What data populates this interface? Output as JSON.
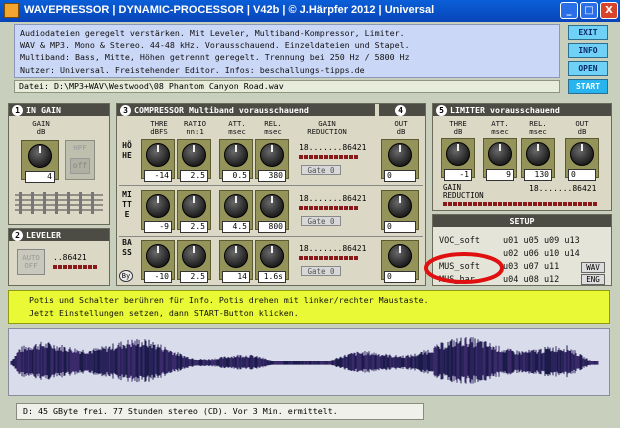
{
  "window": {
    "title": "WAVEPRESSOR | DYNAMIC-PROCESSOR | V42b | © J.Härpfer 2012 | Universal",
    "buttons": {
      "minimize": "_",
      "maximize": "□",
      "close": "X"
    }
  },
  "info": {
    "lines": [
      "Audiodateien geregelt verstärken.  Mit Leveler, Multiband-Kompressor, Limiter.",
      "WAV & MP3. Mono & Stereo. 44-48 kHz. Vorausschauend. Einzeldateien und Stapel.",
      "Multiband: Bass, Mitte, Höhen getrennt geregelt. Trennung bei 250 Hz / 5800 Hz",
      "Nutzer: Universal.     Freistehender Editor. Infos: beschallungs-tipps.de"
    ]
  },
  "side_buttons": {
    "exit": "EXIT",
    "info": "INFO",
    "open": "OPEN",
    "start": "START"
  },
  "file": "Datei: D:\\MP3+WAV\\Westwood\\08 Phantom Canyon Road.wav",
  "in_gain": {
    "number": "1",
    "title": "IN GAIN",
    "gain_label": "GAIN\ndB",
    "gain_value": "4",
    "hpf_label": "HPF",
    "hpf_state": "off"
  },
  "leveler": {
    "number": "2",
    "title": "LEVELER",
    "auto_label": "AUTO\nOFF",
    "meter_label": "..86421"
  },
  "compressor": {
    "number": "3",
    "title": "COMPRESSOR  Multiband  vorausschauend",
    "out_number": "4",
    "headers": {
      "thre": "THRE\ndBFS",
      "ratio": "RATIO\nnn:1",
      "att": "ATT.\nmsec",
      "rel": "REL.\nmsec",
      "gr": "GAIN\nREDUCTION",
      "out": "OUT\ndB"
    },
    "bands": [
      {
        "name": "HÖHE",
        "thre": "-14",
        "ratio": "2.5",
        "att": "0.5",
        "rel": "380",
        "meter": "18.......86421",
        "gate": "Gate 0",
        "out": "0"
      },
      {
        "name": "MITTE",
        "thre": "-9",
        "ratio": "2.5",
        "att": "4.5",
        "rel": "800",
        "meter": "18.......86421",
        "gate": "Gate 0",
        "out": "0"
      },
      {
        "name": "BASS",
        "thre": "-10",
        "ratio": "2.5",
        "att": "14",
        "rel": "1.6s",
        "meter": "18.......86421",
        "gate": "Gate 0",
        "out": "0"
      }
    ],
    "bypass": "By"
  },
  "limiter": {
    "number": "5",
    "title": "LIMITER vorausschauend",
    "headers": {
      "thre": "THRE\ndB",
      "att": "ATT.\nmsec",
      "rel": "REL.\nmsec",
      "out": "OUT\ndB"
    },
    "values": {
      "thre": "-1",
      "att": "9",
      "rel": "130",
      "out": "0"
    },
    "gr_label": "GAIN\nREDUCTION",
    "meter": "18.......86421"
  },
  "setup": {
    "title": "SETUP",
    "rows": [
      {
        "name": "VOC_soft",
        "codes": "u01 u05 u09 u13"
      },
      {
        "name": "",
        "codes": "u02 u06 u10 u14"
      },
      {
        "name": "MUS_soft",
        "codes": "u03 u07 u11",
        "tag": "WAV"
      },
      {
        "name": "MUS_har",
        "codes": "u04 u08 u12",
        "tag": "ENG"
      }
    ]
  },
  "hint": {
    "line1": "Potis und Schalter berühren für Info.        Potis drehen mit linker/rechter Maustaste.",
    "line2": "Jetzt Einstellungen setzen, dann START-Button klicken."
  },
  "status": "D: 45 GByte frei. 77 Stunden stereo (CD). Vor 3 Min. ermittelt.",
  "colors": {
    "titlebar": "#0a5fd8",
    "hint_bg": "#e9f935",
    "accent_circle": "#e01010",
    "button": "#6fd1f5"
  }
}
